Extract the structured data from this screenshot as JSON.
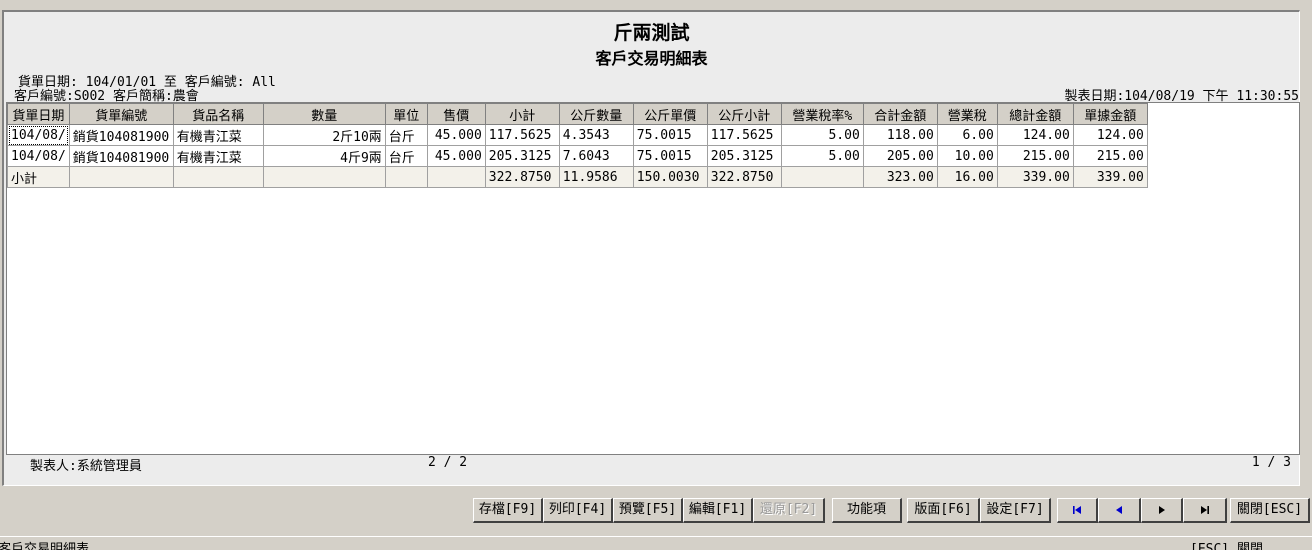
{
  "report": {
    "title": "斤兩測試",
    "subtitle": "客戶交易明細表",
    "header_line1": "貨單日期: 104/01/01 至    客戶編號: All",
    "header_line2": "客戶編號:S002  客戶簡稱:農會",
    "print_date": "製表日期:104/08/19 下午 11:30:55"
  },
  "table": {
    "columns": [
      "貨單日期",
      "貨單編號",
      "貨品名稱",
      "數量",
      "單位",
      "售價",
      "小計",
      "公斤數量",
      "公斤單價",
      "公斤小計",
      "營業稅率%",
      "合計金額",
      "營業稅",
      "總計金額",
      "單據金額"
    ],
    "rows": [
      [
        "104/08/",
        "銷貨104081900",
        "有機青江菜",
        "2斤10兩",
        "台斤",
        "45.000",
        "117.5625",
        "4.3543",
        "75.0015",
        "117.5625",
        "5.00",
        "118.00",
        "6.00",
        "124.00",
        "124.00"
      ],
      [
        "104/08/",
        "銷貨104081900",
        "有機青江菜",
        "4斤9兩",
        "台斤",
        "45.000",
        "205.3125",
        "7.6043",
        "75.0015",
        "205.3125",
        "5.00",
        "205.00",
        "10.00",
        "215.00",
        "215.00"
      ]
    ],
    "subtotal": [
      "小計",
      "",
      "",
      "",
      "",
      "",
      "322.8750",
      "11.9586",
      "150.0030",
      "322.8750",
      "",
      "323.00",
      "16.00",
      "339.00",
      "339.00"
    ]
  },
  "footer": {
    "maker": "製表人:系統管理員",
    "page": "2 / 2",
    "page_right": "1 / 3"
  },
  "buttons": {
    "save": "存檔[F9]",
    "print": "列印[F4]",
    "preview": "預覽[F5]",
    "edit": "編輯[F1]",
    "restore": "還原[F2]",
    "functions": "功能項",
    "layout": "版面[F6]",
    "settings": "設定[F7]",
    "close": "關閉[ESC]"
  },
  "status": {
    "left": "客戶交易明細表",
    "right": "[ESC] 關閉"
  },
  "colors": {
    "nav_icon": "#0000cc",
    "face": "#d4d0c8"
  }
}
